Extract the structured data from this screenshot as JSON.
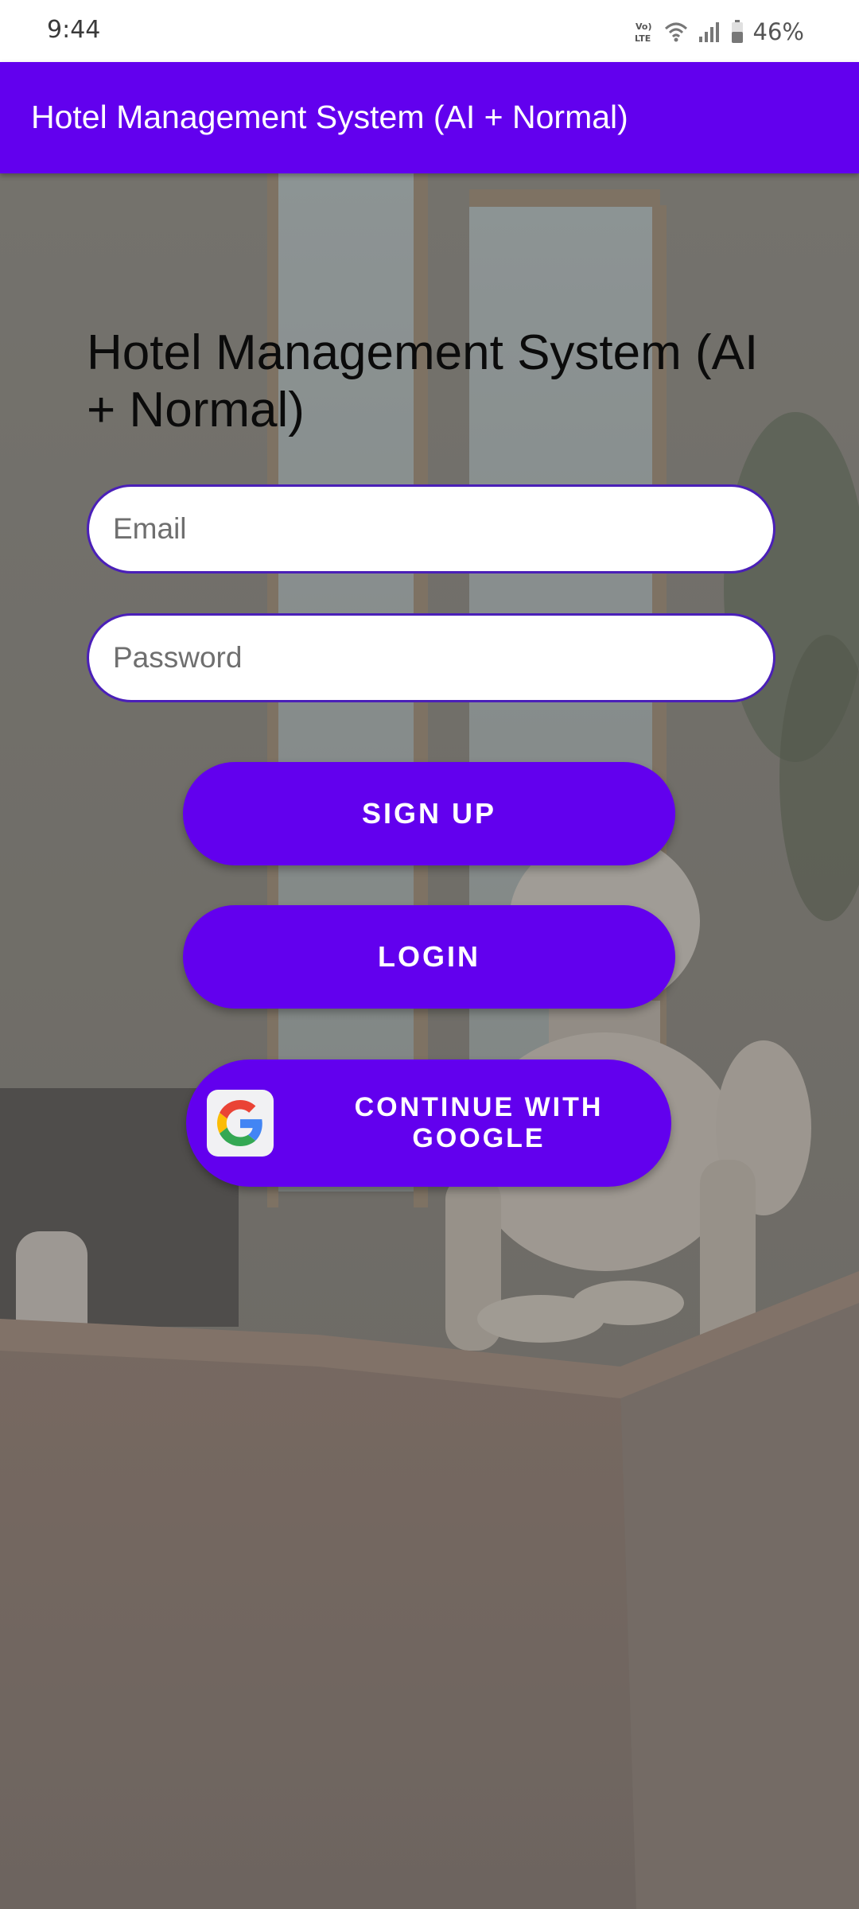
{
  "status_bar": {
    "time": "9:44",
    "battery_percent": "46%",
    "icons": [
      "volte-icon",
      "wifi-icon",
      "signal-icon",
      "battery-icon"
    ]
  },
  "app_bar": {
    "title": "Hotel Management System (AI + Normal)"
  },
  "login_form": {
    "heading": "Hotel Management System (AI + Normal)",
    "email_placeholder": "Email",
    "password_placeholder": "Password",
    "signup_label": "SIGN UP",
    "login_label": "LOGIN",
    "google_label": "CONTINUE WITH GOOGLE"
  },
  "colors": {
    "primary": "#6200ee",
    "field_border": "#4a1fb8",
    "status_bar_bg": "#ffffff"
  }
}
